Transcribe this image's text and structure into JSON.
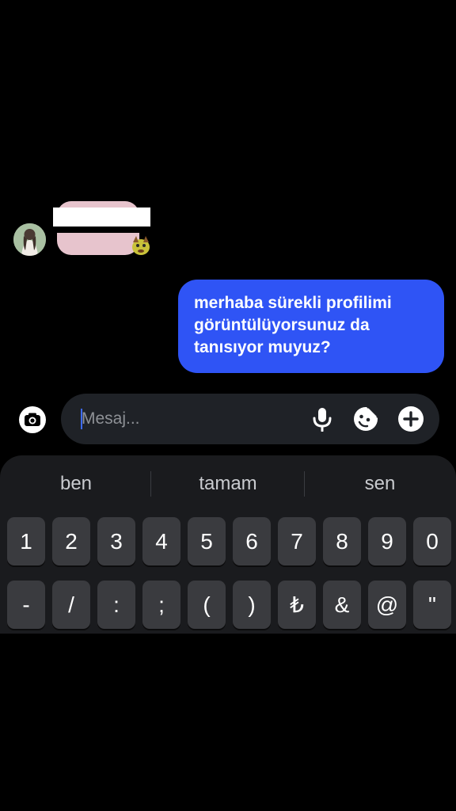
{
  "conversation": {
    "incoming_message": {
      "redacted": true,
      "reaction": "sticker-reaction-icon"
    },
    "outgoing_message": {
      "text": "merhaba sürekli profilimi\ngörüntülüyorsunuz da\ntanısıyor muyuz?"
    }
  },
  "composer": {
    "placeholder": "Mesaj...",
    "value": "",
    "icons": [
      "camera-icon",
      "microphone-icon",
      "sticker-icon",
      "add-icon"
    ]
  },
  "keyboard": {
    "suggestions": [
      "ben",
      "tamam",
      "sen"
    ],
    "row1": [
      "1",
      "2",
      "3",
      "4",
      "5",
      "6",
      "7",
      "8",
      "9",
      "0"
    ],
    "row2": [
      "-",
      "/",
      ":",
      ";",
      "(",
      ")",
      "₺",
      "&",
      "@",
      "\""
    ]
  },
  "colors": {
    "background": "#000000",
    "outgoing_bubble": "#2f54f5",
    "incoming_bubble": "#e7c4cd",
    "composer": "#1f2227",
    "keyboard": "#1a1b1e",
    "key": "#3a3b3f",
    "caret": "#3d6bff"
  }
}
